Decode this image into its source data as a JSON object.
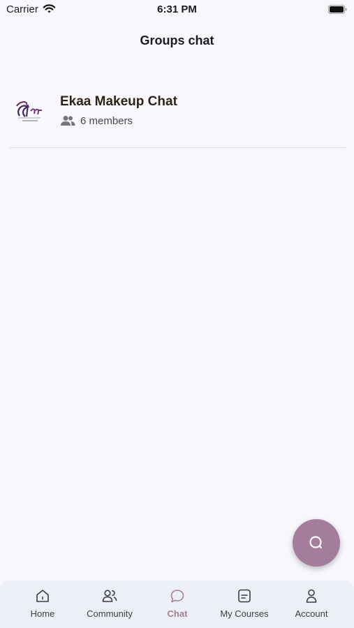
{
  "status_bar": {
    "carrier": "Carrier",
    "time": "6:31 PM"
  },
  "header": {
    "title": "Groups chat"
  },
  "groups": [
    {
      "name": "Ekaa Makeup Chat",
      "members": "6 members",
      "logo_icon": "ekaa-makeup-logo"
    }
  ],
  "fab": {
    "icon": "search-icon",
    "color": "#a57d9c"
  },
  "bottom_nav": {
    "items": [
      {
        "label": "Home",
        "icon": "home-icon"
      },
      {
        "label": "Community",
        "icon": "community-icon"
      },
      {
        "label": "Chat",
        "icon": "chat-icon",
        "active": true
      },
      {
        "label": "My Courses",
        "icon": "courses-icon"
      },
      {
        "label": "Account",
        "icon": "account-icon"
      }
    ],
    "active_color": "#a57d9c"
  }
}
